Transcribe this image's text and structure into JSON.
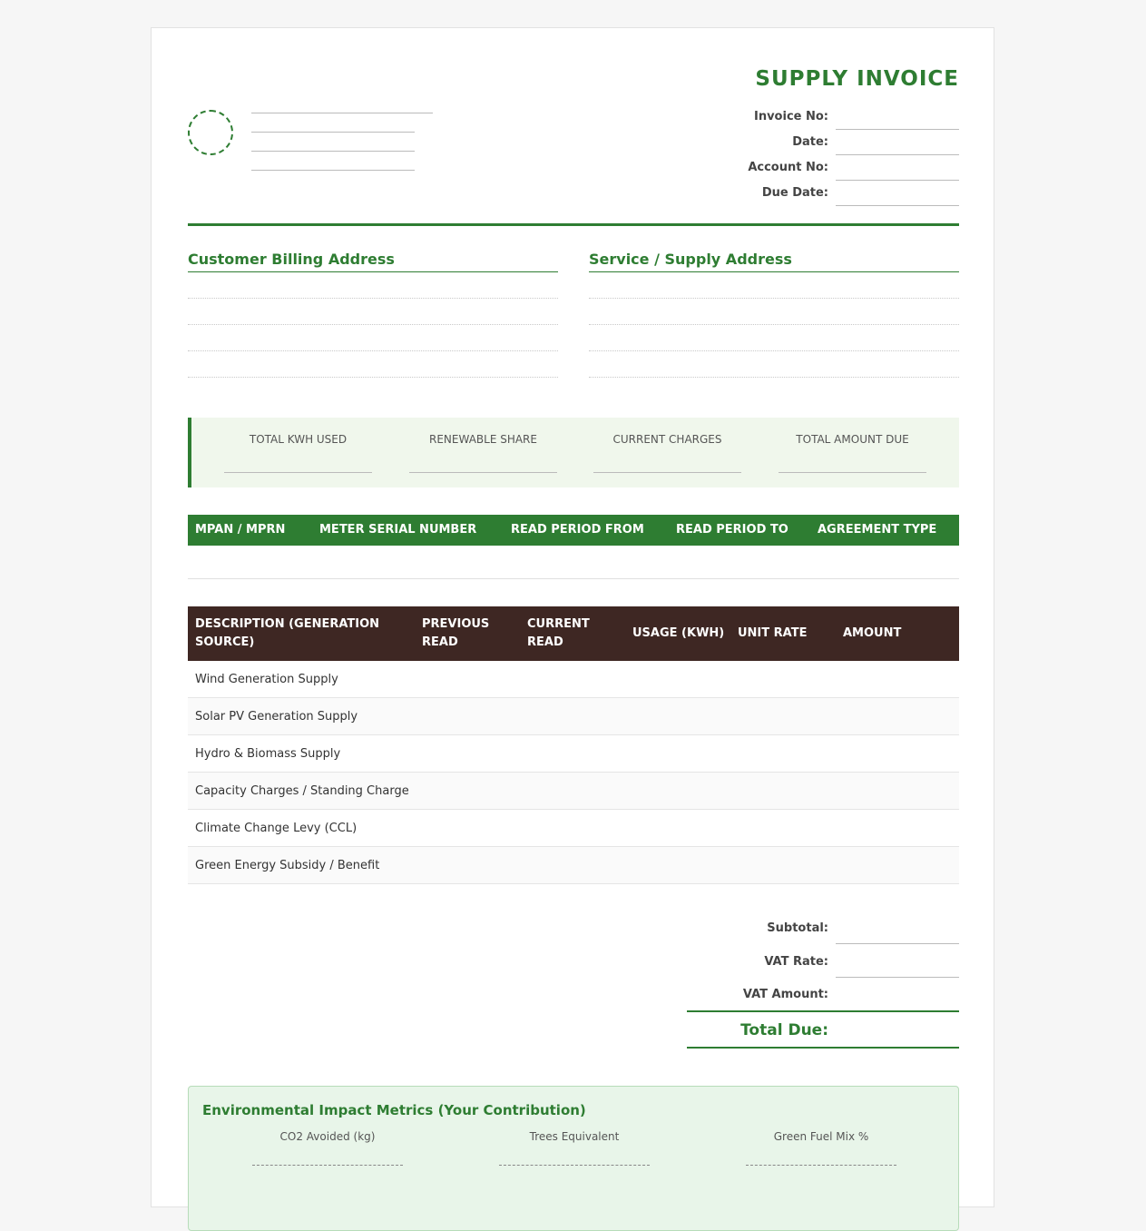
{
  "header": {
    "title": "SUPPLY INVOICE",
    "meta_labels": [
      "Invoice No:",
      "Date:",
      "Account No:",
      "Due Date:"
    ]
  },
  "addresses": {
    "billing_title": "Customer Billing Address",
    "supply_title": "Service / Supply Address"
  },
  "summary": {
    "labels": [
      "TOTAL KWH USED",
      "RENEWABLE SHARE",
      "CURRENT CHARGES",
      "TOTAL AMOUNT DUE"
    ]
  },
  "meter_table": {
    "headers": [
      "MPAN / MPRN",
      "METER SERIAL NUMBER",
      "READ PERIOD FROM",
      "READ PERIOD TO",
      "AGREEMENT TYPE"
    ]
  },
  "charges_table": {
    "headers": [
      {
        "line1": "DESCRIPTION (GENERATION",
        "line2": "SOURCE)"
      },
      {
        "line1": "PREVIOUS",
        "line2": "READ"
      },
      {
        "line1": "CURRENT",
        "line2": "READ"
      },
      {
        "line1": "USAGE (KWH)",
        "line2": ""
      },
      {
        "line1": "UNIT RATE",
        "line2": ""
      },
      {
        "line1": "AMOUNT",
        "line2": ""
      }
    ],
    "rows": [
      "Wind Generation Supply",
      "Solar PV Generation Supply",
      "Hydro & Biomass Supply",
      "Capacity Charges / Standing Charge",
      "Climate Change Levy (CCL)",
      "Green Energy Subsidy / Benefit"
    ]
  },
  "totals": {
    "subtotal_label": "Subtotal:",
    "vat_rate_label": "VAT Rate:",
    "vat_amount_label": "VAT Amount:",
    "total_due_label": "Total Due:"
  },
  "environment": {
    "title": "Environmental Impact Metrics (Your Contribution)",
    "labels": [
      "CO2 Avoided (kg)",
      "Trees Equivalent",
      "Green Fuel Mix %"
    ]
  },
  "colors": {
    "accent_green": "#2e7d32",
    "dark_brown": "#3e2723",
    "summary_bg": "#f0f7ec",
    "env_bg": "#e8f5e9"
  }
}
